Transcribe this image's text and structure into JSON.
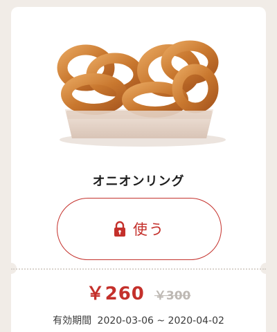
{
  "coupon": {
    "product_name": "オニオンリング",
    "use_button_label": "使う",
    "price_current": "￥260",
    "price_original": "￥300",
    "validity_label": "有効期間",
    "validity_range": "2020-03-06 ~ 2020-04-02",
    "image_alt": "onion-rings-photo"
  },
  "colors": {
    "accent": "#c4302b",
    "background": "#f1ece7",
    "card": "#ffffff",
    "muted": "#bdb8b3"
  },
  "icons": {
    "lock": "lock-icon"
  }
}
